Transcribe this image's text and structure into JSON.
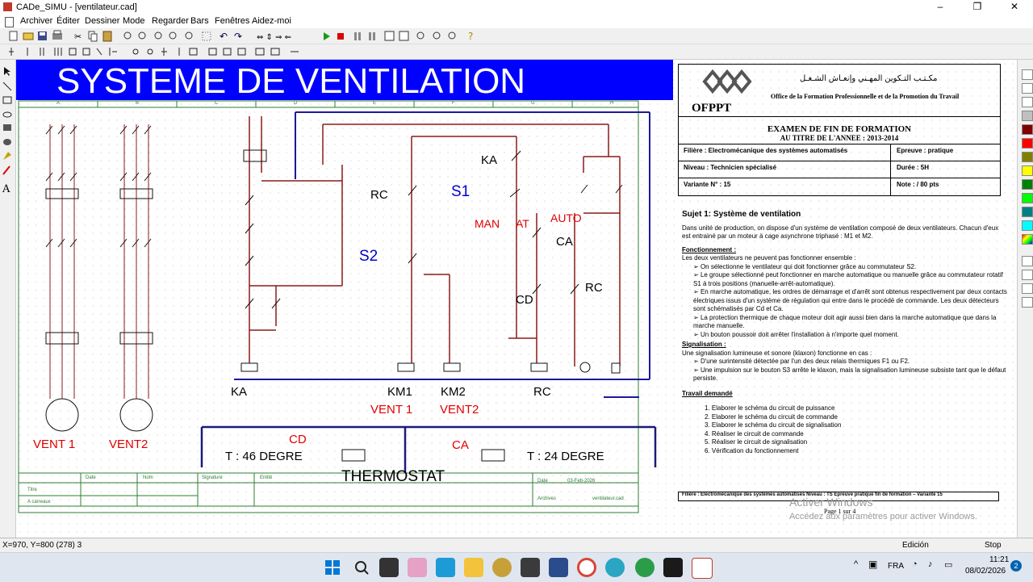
{
  "window": {
    "title": "CADe_SIMU - [ventilateur.cad]",
    "min": "–",
    "max": "❐",
    "close": "✕"
  },
  "menu": [
    "Archiver",
    "Éditer",
    "Dessiner",
    "Mode",
    "Regarder",
    "Bars",
    "Fenêtres",
    "Aidez-moi"
  ],
  "drawing": {
    "banner_title": "SYSTEME DE VENTILATION",
    "col_letters": [
      "A",
      "B",
      "C",
      "D",
      "E",
      "F",
      "G",
      "H"
    ],
    "motor_labels": [
      "VENT 1",
      "VENT2"
    ],
    "coil_labels": [
      "KA",
      "KM1",
      "KM2",
      "RC"
    ],
    "vent_labels": [
      "VENT 1",
      "VENT2"
    ],
    "big_labels": {
      "s1": "S1",
      "s2": "S2",
      "ka": "KA",
      "rc": "RC",
      "ca": "CA",
      "cd": "CD",
      "rc2": "RC"
    },
    "mode_labels": {
      "man": "MAN",
      "at": "AT",
      "auto": "AUTO"
    },
    "thermostat": {
      "cd_label": "CD",
      "ca_label": "CA",
      "t1": "T : 46 DEGRE",
      "t2": "T : 24 DEGRE",
      "title": "THERMOSTAT"
    },
    "cartouche": {
      "date": "Date",
      "nom": "Nom",
      "signature": "Signature",
      "entite": "Entité",
      "titre": "Titre",
      "a_carreaux": "A carreaux",
      "date2": "Date",
      "date_val": "03-Feb-2026",
      "archives": "Archives",
      "file": "ventilateur.cad"
    }
  },
  "document": {
    "org_ar": "مكـتـب التـكوين المهـني وإنعـاش الشـغـل",
    "org_fr": "Office de la Formation Professionnelle et de la Promotion du Travail",
    "ofppt": "OFPPT",
    "exam_title": "EXAMEN DE FIN DE FORMATION",
    "exam_sub": "AU TITRE DE L'ANNEE : 2013-2014",
    "info": [
      [
        "Filière : Electromécanique des systèmes automatisés",
        "Epreuve  : pratique"
      ],
      [
        "Niveau : Technicien spécialisé",
        "Durée      : 5H"
      ],
      [
        "Variante N° : 15",
        "Note        : / 80 pts"
      ]
    ],
    "subject_title": "Sujet 1: Système de ventilation",
    "intro": "Dans unité de production, on dispose d'un système de ventilation composé de deux ventilateurs. Chacun d'eux est entrainé par un moteur à cage asynchrone triphasé : M1 et M2.",
    "fonct_title": "Fonctionnement :",
    "fonct_intro": "Les deux ventilateurs ne peuvent pas fonctionner ensemble :",
    "fonct_items": [
      "On sélectionne le ventilateur qui doit fonctionner grâce au commutateur S2.",
      "Le groupe sélectionné peut fonctionner en marche automatique ou manuelle grâce au commutateur rotatif S1 à trois positions (manuelle-arrêt-automatique).",
      "En marche automatique, les ordres de démarrage et d'arrêt sont obtenus respectivement par deux contacts électriques issus d'un système de régulation qui entre dans le procédé de commande. Les deux détecteurs sont schématisés par Cd et Ca.",
      "La protection thermique de chaque moteur doit agir aussi bien dans la marche automatique que dans la marche manuelle.",
      "Un bouton poussoir doit arrêter l'installation à n'importe quel moment."
    ],
    "sig_title": "Signalisation :",
    "sig_intro": "Une signalisation lumineuse et sonore (klaxon) fonctionne en cas :",
    "sig_items": [
      "D'une surintensité détectée par l'un des deux relais thermiques F1 ou F2.",
      "Une impulsion sur le bouton S3 arrête le klaxon, mais la signalisation lumineuse subsiste tant que le défaut persiste."
    ],
    "travail_title": "Travail demandé",
    "travail_items": [
      "1.  Elaborer le schéma du circuit de puissance",
      "2.  Elaborer le schéma du circuit de commande",
      "3.  Elaborer le schéma du circuit de signalisation",
      "4.  Réaliser le circuit de commande",
      "5.  Réaliser le circuit de signalisation",
      "6.  Vérification du fonctionnement"
    ],
    "footer": "Filière : Electromécanique des systèmes automatisés    Niveau : TS          Epreuve pratique fin de formation – Variante 15",
    "page": "Page 1 sur 4",
    "watermark1": "Activer Windows",
    "watermark2": "Accédez aux paramètres pour activer Windows."
  },
  "status": {
    "coords": "X=970, Y=800 (278) 3",
    "mode": "Edición",
    "sim": "Stop"
  },
  "taskbar": {
    "lang": "FRA",
    "time": "11:21",
    "date": "08/02/2026",
    "badge": "2"
  },
  "colors": {
    "banner": "#0000ff",
    "wire": "#8b1a1a",
    "label_red": "#e00000",
    "label_blue": "#0000cc"
  }
}
